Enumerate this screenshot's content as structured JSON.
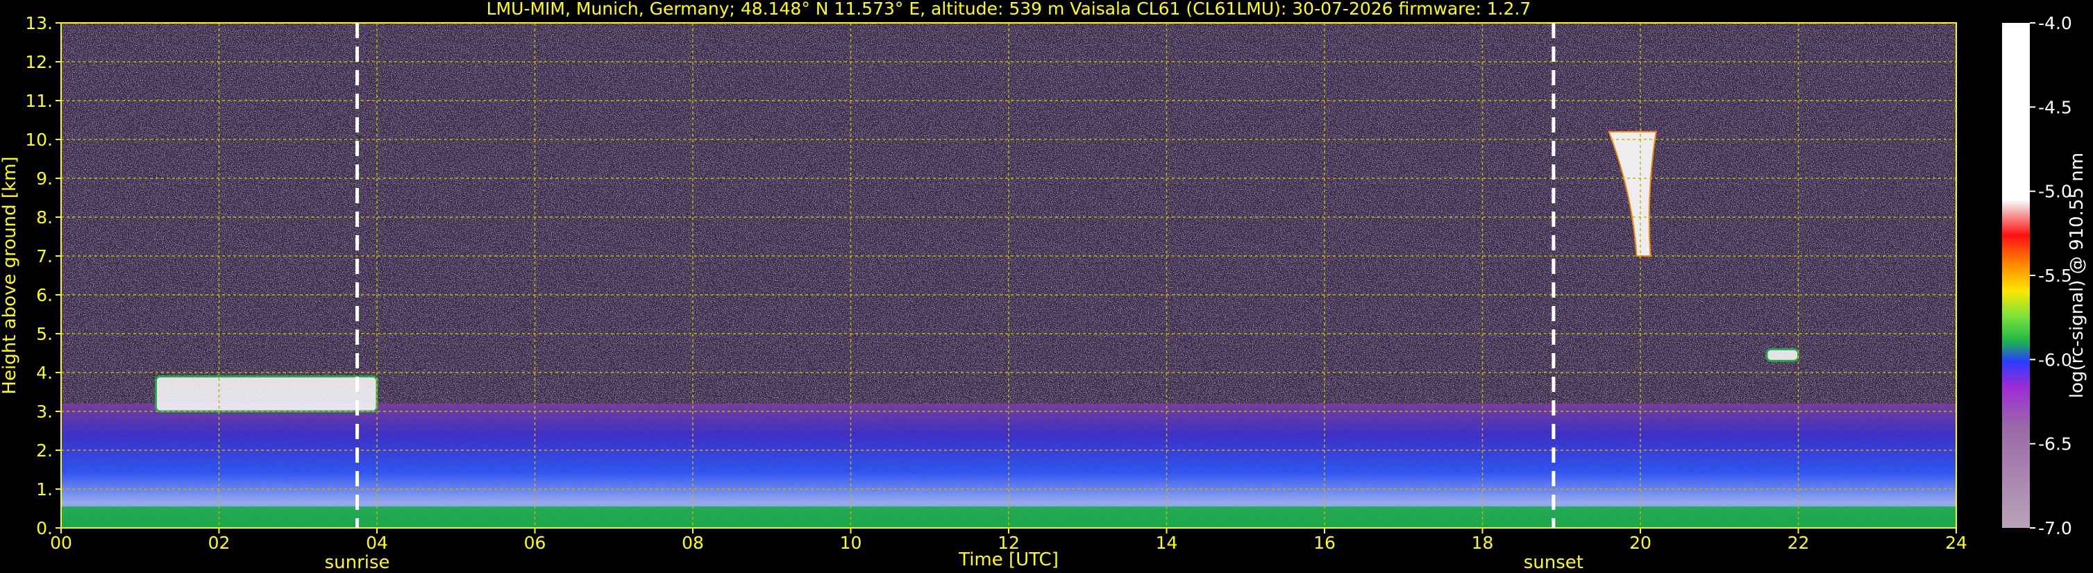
{
  "chart_data": {
    "type": "heatmap",
    "title": "LMU-MIM, Munich, Germany; 48.148° N 11.573° E, altitude: 539 m    Vaisala CL61 (CL61LMU): 30-07-2026    firmware: 1.2.7",
    "xlabel": "Time [UTC]",
    "ylabel": "Height above ground [km]",
    "xlim": [
      0,
      24
    ],
    "ylim": [
      0,
      13
    ],
    "x_ticks": [
      "00",
      "02",
      "04",
      "06",
      "08",
      "10",
      "12",
      "14",
      "16",
      "18",
      "20",
      "22",
      "24"
    ],
    "y_ticks": [
      "0.",
      "1.",
      "2.",
      "3.",
      "4.",
      "5.",
      "6.",
      "7.",
      "8.",
      "9.",
      "10.",
      "11.",
      "12.",
      "13."
    ],
    "grid": true,
    "colorbar": {
      "label": "log(rc-signal) @ 910.55 nm",
      "range": [
        -7.0,
        -4.0
      ],
      "ticks": [
        "-4.0",
        "-4.5",
        "-5.0",
        "-5.5",
        "-6.0",
        "-6.5",
        "-7.0"
      ]
    },
    "annotations": [
      {
        "label": "sunrise",
        "x": 3.75
      },
      {
        "label": "sunset",
        "x": 18.9
      }
    ],
    "features": [
      {
        "kind": "boundary-layer",
        "x0": 0,
        "x1": 24,
        "top_km": 3.2
      },
      {
        "kind": "cloud",
        "x0": 1.2,
        "x1": 4.0,
        "y0": 3.0,
        "y1": 3.9
      },
      {
        "kind": "cirrus",
        "x0": 19.6,
        "x1": 20.2,
        "y0": 7.0,
        "y1": 10.2
      },
      {
        "kind": "cloud",
        "x0": 21.6,
        "x1": 22.0,
        "y0": 4.3,
        "y1": 4.6
      }
    ]
  }
}
